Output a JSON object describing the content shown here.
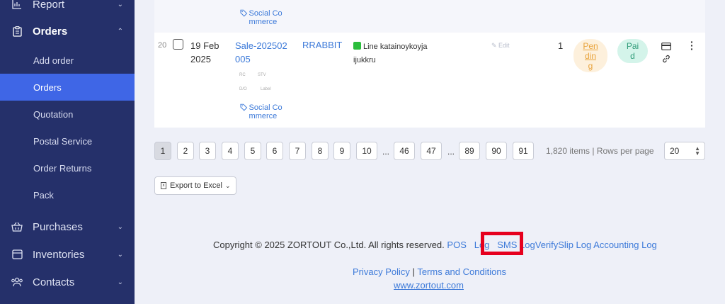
{
  "sidebar": {
    "report": "Report",
    "orders": "Orders",
    "sub_items": [
      "Add order",
      "Orders",
      "Quotation",
      "Postal Service",
      "Order Returns",
      "Pack"
    ],
    "purchases": "Purchases",
    "inventories": "Inventories",
    "contacts": "Contacts",
    "active_color": "#3f66e6",
    "background_color": "#25306a"
  },
  "table": {
    "prev_row_tag": "Social Co mmerce",
    "row": {
      "index": "20",
      "date": "19 Feb 2025",
      "sale_no": "Sale-202502 005",
      "mini_labels": [
        "RC",
        "STV",
        "D/O",
        "Label"
      ],
      "tag": "Social Co mmerce",
      "customer": "RRABBIT",
      "channel": "Line katainoykoyja ijukkru",
      "edit": "Edit",
      "qty": "1",
      "status": "Pen din g",
      "payment": "Pai d"
    }
  },
  "pagination": {
    "pages": [
      "1",
      "2",
      "3",
      "4",
      "5",
      "6",
      "7",
      "8",
      "9",
      "10",
      "46",
      "47",
      "89",
      "90",
      "91"
    ],
    "ellipsis": "...",
    "info": "1,820 items | Rows per page",
    "rows_per_page": "20"
  },
  "export_label": "Export to Excel",
  "footer": {
    "copyright": "Copyright © 2025 ZORTOUT Co.,Ltd. All rights reserved.",
    "pos_log": "POS",
    "log": "Log",
    "sms_log": "SMS Log",
    "verifyslip_log": "VerifySlip Log",
    "accounting_log": "Accounting Log",
    "privacy": "Privacy Policy",
    "separator": "|",
    "terms": "Terms and Conditions",
    "website": "www.zortout.com"
  }
}
